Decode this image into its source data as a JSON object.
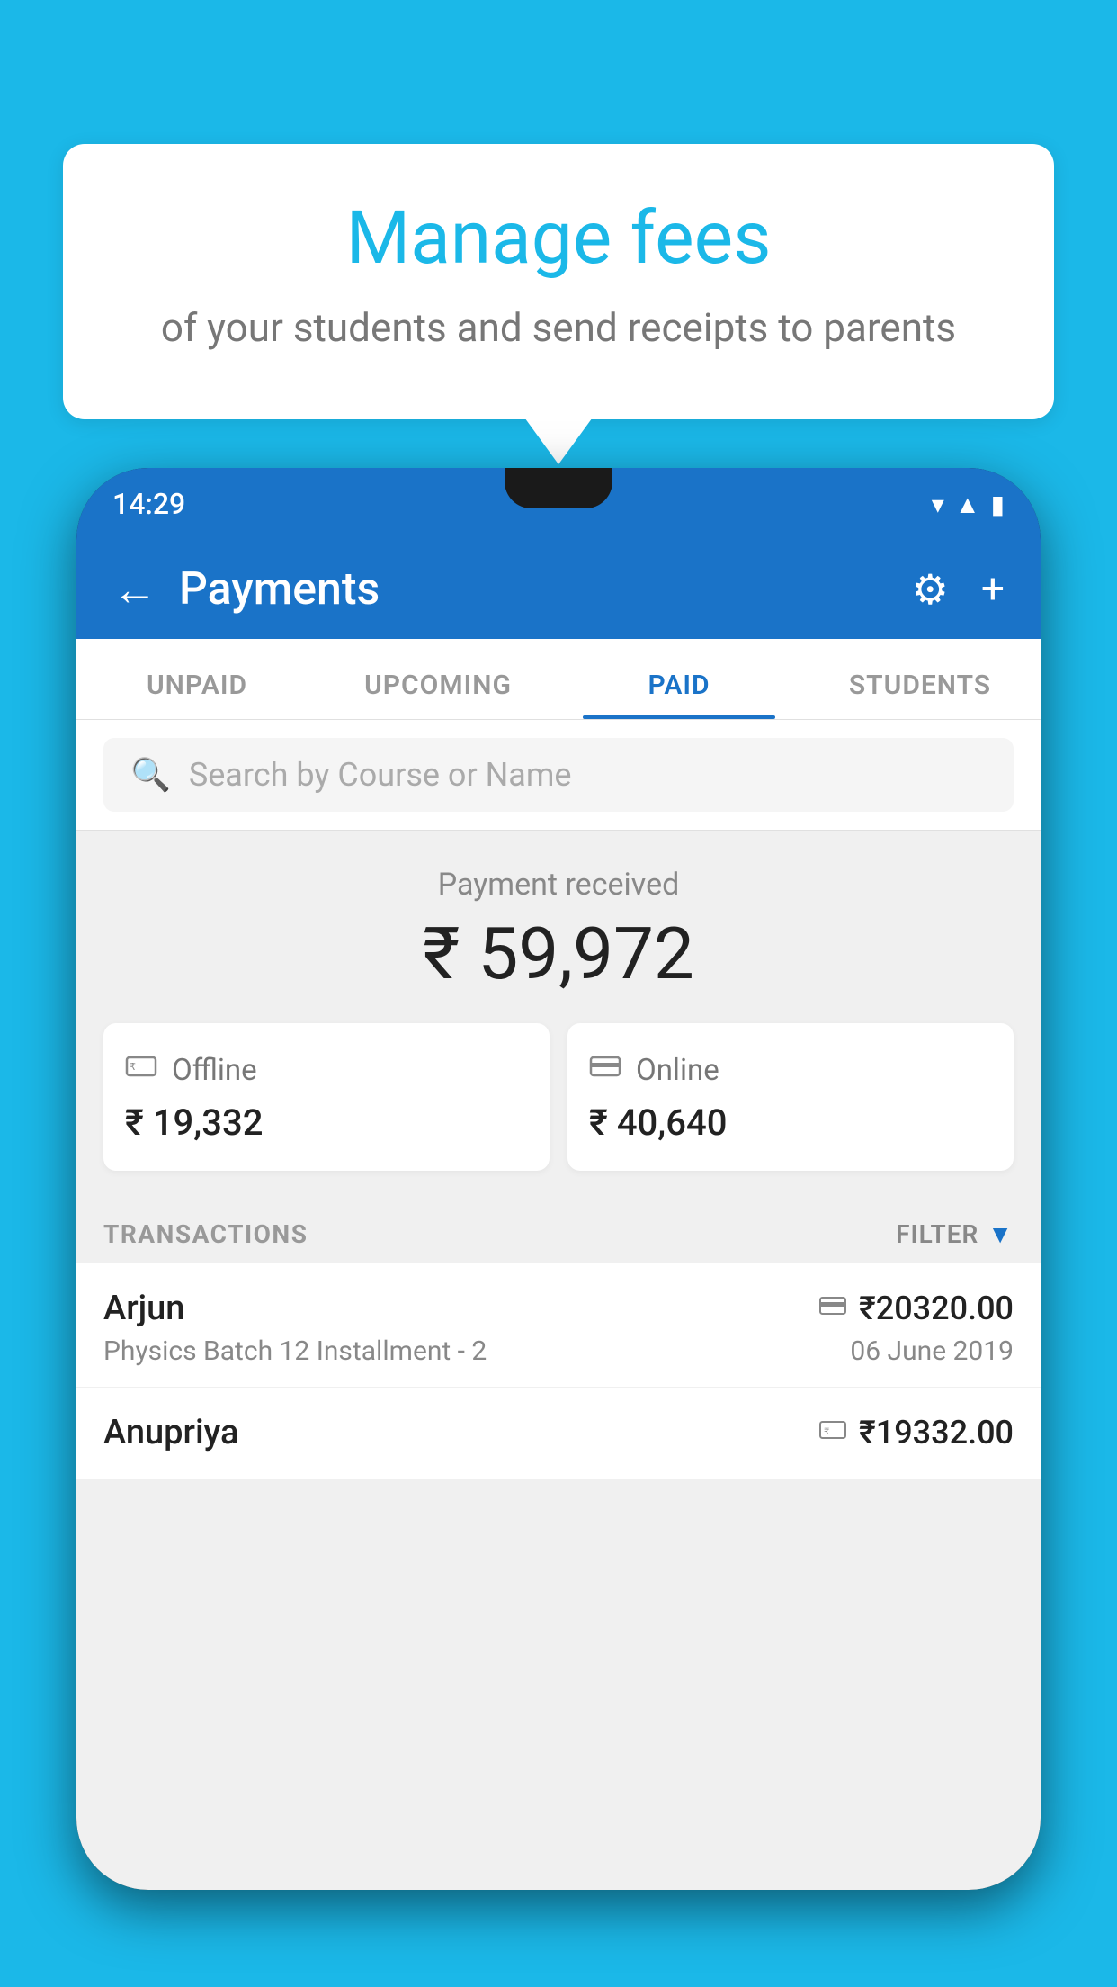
{
  "background_color": "#1BB8E8",
  "bubble": {
    "title": "Manage fees",
    "subtitle": "of your students and send receipts to parents"
  },
  "phone": {
    "status_bar": {
      "time": "14:29",
      "icons": [
        "wifi",
        "signal",
        "battery"
      ]
    },
    "header": {
      "title": "Payments",
      "back_label": "←",
      "settings_icon": "gear",
      "add_icon": "+"
    },
    "tabs": [
      {
        "label": "UNPAID",
        "active": false
      },
      {
        "label": "UPCOMING",
        "active": false
      },
      {
        "label": "PAID",
        "active": true
      },
      {
        "label": "STUDENTS",
        "active": false
      }
    ],
    "search": {
      "placeholder": "Search by Course or Name"
    },
    "payment_summary": {
      "label": "Payment received",
      "amount": "₹ 59,972",
      "offline": {
        "icon": "rupee-card",
        "label": "Offline",
        "amount": "₹ 19,332"
      },
      "online": {
        "icon": "credit-card",
        "label": "Online",
        "amount": "₹ 40,640"
      }
    },
    "transactions": {
      "header_label": "TRANSACTIONS",
      "filter_label": "FILTER",
      "rows": [
        {
          "name": "Arjun",
          "course": "Physics Batch 12 Installment - 2",
          "amount": "₹20320.00",
          "date": "06 June 2019",
          "icon": "credit-card"
        },
        {
          "name": "Anupriya",
          "course": "",
          "amount": "₹19332.00",
          "date": "",
          "icon": "rupee-card"
        }
      ]
    }
  }
}
